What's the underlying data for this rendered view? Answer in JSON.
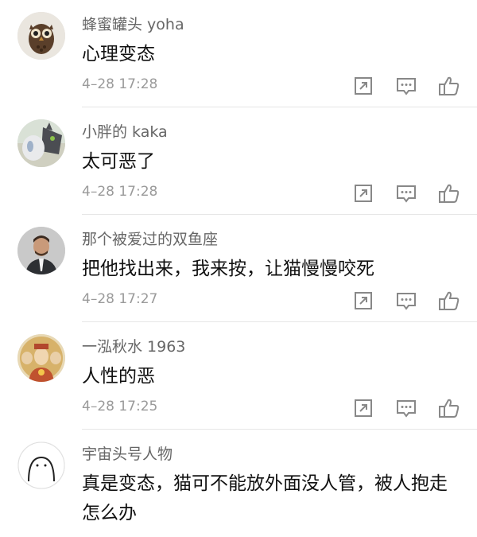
{
  "comments": [
    {
      "user": "蜂蜜罐头 yoha",
      "text": "心理变态",
      "time": "4–28 17:28",
      "avatar": "owl-avatar"
    },
    {
      "user": "小胖的 kaka",
      "text": "太可恶了",
      "time": "4–28 17:28",
      "avatar": "cat-avatar"
    },
    {
      "user": "那个被爱过的双鱼座",
      "text": "把他找出来，我来按，让猫慢慢咬死",
      "time": "4–28 17:27",
      "avatar": "man-avatar"
    },
    {
      "user": "一泓秋水 1963",
      "text": "人性的恶",
      "time": "4–28 17:25",
      "avatar": "deity-avatar"
    },
    {
      "user": "宇宙头号人物",
      "text": "真是变态，猫可不能放外面没人管，被人抱走怎么办",
      "avatar": "cartoon-avatar"
    }
  ],
  "icons": {
    "forward": "forward-icon",
    "reply": "reply-icon",
    "like": "thumbs-up-icon"
  },
  "colors": {
    "username": "#666666",
    "content": "#111111",
    "time": "#9a9a9a",
    "icon": "#888888"
  }
}
